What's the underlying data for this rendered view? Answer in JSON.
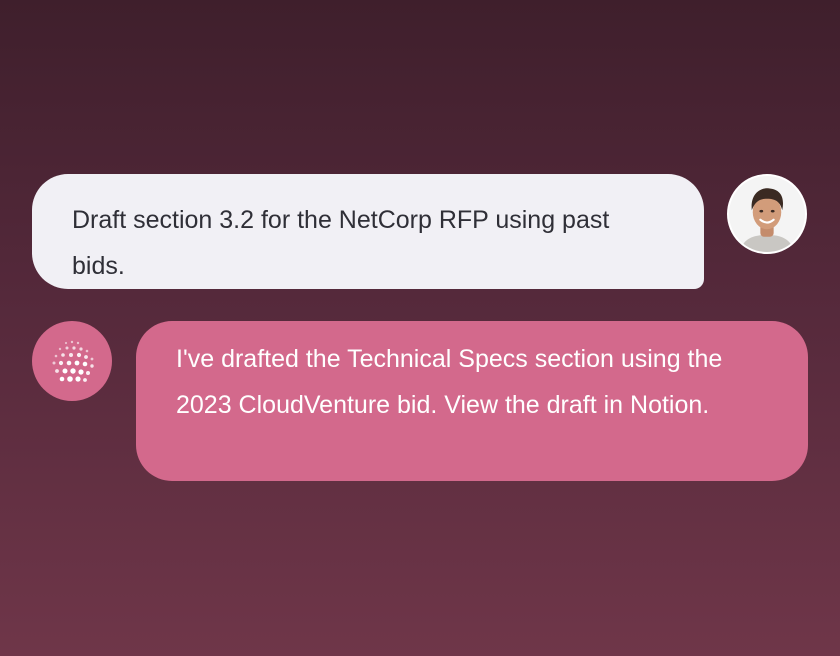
{
  "conversation": {
    "messages": [
      {
        "role": "user",
        "text": "Draft section 3.2 for the NetCorp RFP using past bids.",
        "avatar_icon": "user-photo-avatar"
      },
      {
        "role": "assistant",
        "text": "I've drafted the Technical Specs section using the 2023 CloudVenture bid. View the draft in Notion.",
        "avatar_icon": "dotted-sphere-logo"
      }
    ]
  },
  "colors": {
    "background_top": "#3f1f2c",
    "background_bottom": "#6f3649",
    "user_bubble": "#f1f0f5",
    "assistant_bubble": "#d3698c",
    "user_text": "#2f2f37",
    "assistant_text": "#ffffff"
  }
}
